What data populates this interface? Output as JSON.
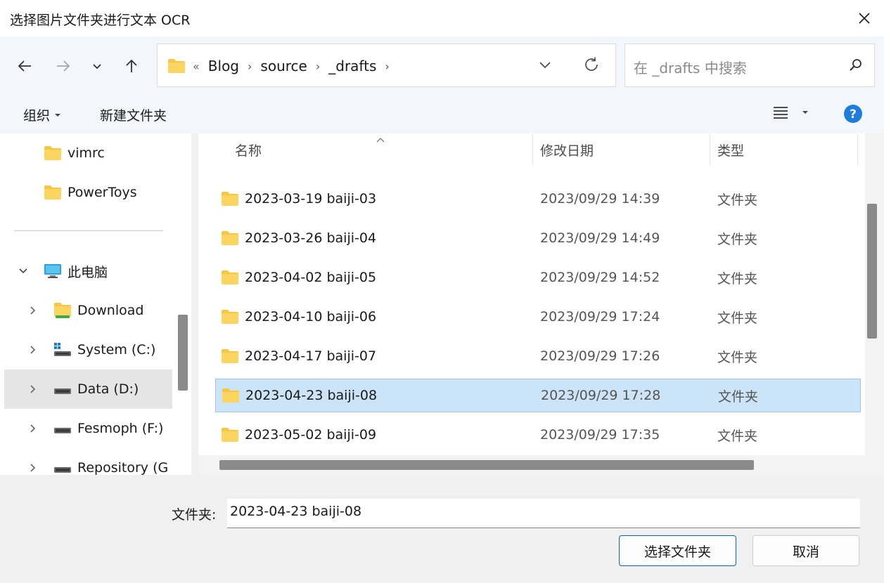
{
  "window": {
    "title": "选择图片文件夹进行文本 OCR"
  },
  "navbar": {
    "breadcrumb": [
      "Blog",
      "source",
      "_drafts"
    ],
    "search_placeholder": "在 _drafts 中搜索"
  },
  "toolbar": {
    "organize_label": "组织",
    "new_folder_label": "新建文件夹"
  },
  "sidebar": {
    "items": [
      {
        "label": "vimrc",
        "icon": "folder-icon"
      },
      {
        "label": "PowerToys",
        "icon": "folder-icon"
      },
      {
        "label": "此电脑",
        "icon": "computer-icon",
        "expanded": true
      },
      {
        "label": "Download",
        "icon": "folder-icon"
      },
      {
        "label": "System (C:)",
        "icon": "windows-drive-icon"
      },
      {
        "label": "Data (D:)",
        "icon": "drive-icon",
        "selected": true
      },
      {
        "label": "Fesmoph (F:)",
        "icon": "drive-icon"
      },
      {
        "label": "Repository (G",
        "icon": "drive-icon"
      }
    ]
  },
  "filelist": {
    "columns": {
      "name": "名称",
      "date": "修改日期",
      "type": "类型"
    },
    "rows": [
      {
        "name": "2023-03-19 baiji-03",
        "date": "2023/09/29 14:39",
        "type": "文件夹"
      },
      {
        "name": "2023-03-26 baiji-04",
        "date": "2023/09/29 14:49",
        "type": "文件夹"
      },
      {
        "name": "2023-04-02 baiji-05",
        "date": "2023/09/29 14:52",
        "type": "文件夹"
      },
      {
        "name": "2023-04-10 baiji-06",
        "date": "2023/09/29 17:24",
        "type": "文件夹"
      },
      {
        "name": "2023-04-17 baiji-07",
        "date": "2023/09/29 17:26",
        "type": "文件夹"
      },
      {
        "name": "2023-04-23 baiji-08",
        "date": "2023/09/29 17:28",
        "type": "文件夹",
        "selected": true
      },
      {
        "name": "2023-05-02 baiji-09",
        "date": "2023/09/29 17:35",
        "type": "文件夹"
      }
    ]
  },
  "footer": {
    "folder_label": "文件夹:",
    "folder_value": "2023-04-23 baiji-08",
    "select_button": "选择文件夹",
    "cancel_button": "取消"
  },
  "colors": {
    "accent": "#0067c0",
    "selection": "#cce4f7",
    "folder": "#f8c641"
  }
}
